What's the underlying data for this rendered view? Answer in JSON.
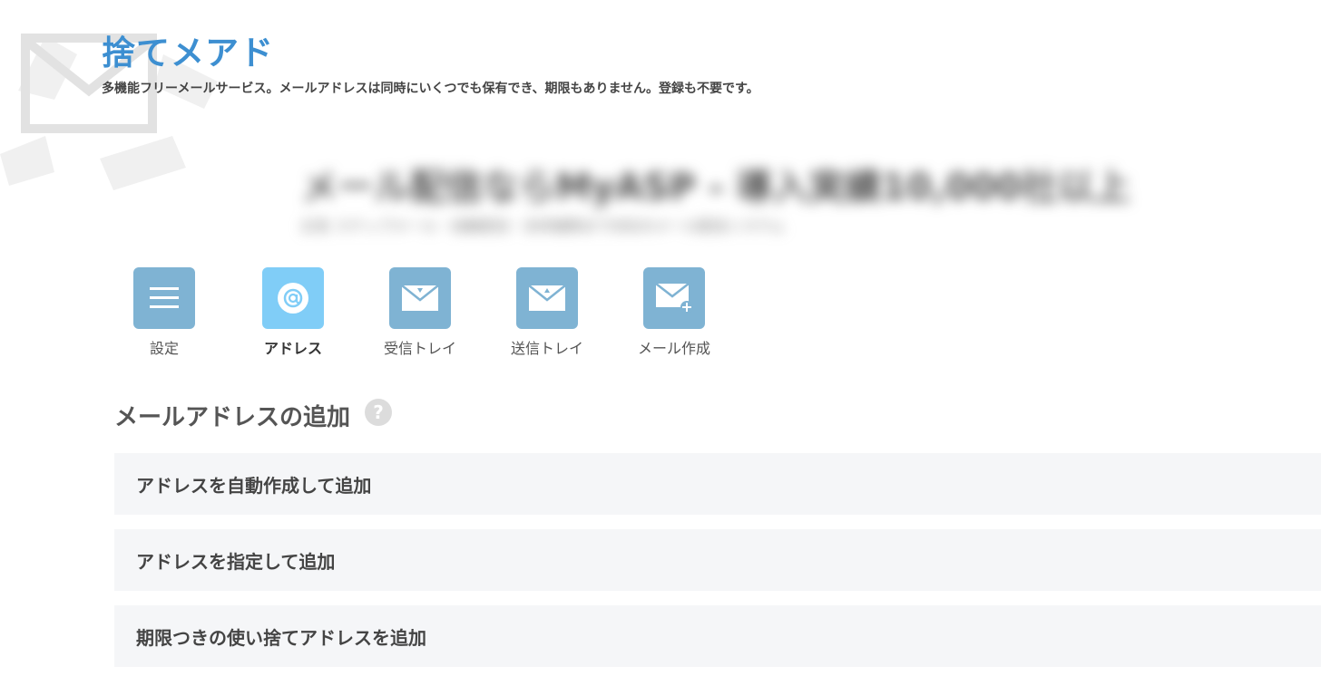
{
  "header": {
    "title": "捨てメアド",
    "description": "多機能フリーメールサービス。メールアドレスは同時にいくつでも保有でき、期限もありません。登録も不要です。"
  },
  "ad": {
    "headline": "メール配信ならMyASP - 導入実績10,000社以上",
    "subtext": "広告 ステップメール・自動配信・決済連携まで対応のメール配信システム"
  },
  "nav": {
    "items": [
      {
        "label": "設定",
        "icon": "menu-icon",
        "active": false
      },
      {
        "label": "アドレス",
        "icon": "at-sign-icon",
        "active": true
      },
      {
        "label": "受信トレイ",
        "icon": "inbox-mail-icon",
        "active": false
      },
      {
        "label": "送信トレイ",
        "icon": "outbox-mail-icon",
        "active": false
      },
      {
        "label": "メール作成",
        "icon": "compose-mail-icon",
        "active": false
      }
    ]
  },
  "section": {
    "title": "メールアドレスの追加",
    "help_icon": "question-icon"
  },
  "options": [
    {
      "label": "アドレスを自動作成して追加"
    },
    {
      "label": "アドレスを指定して追加"
    },
    {
      "label": "期限つきの使い捨てアドレスを追加"
    }
  ],
  "colors": {
    "title": "#3d8fd1",
    "nav_icon": "#7fb3d3",
    "nav_icon_active": "#80cdf7",
    "option_bg": "#f5f6f8"
  }
}
